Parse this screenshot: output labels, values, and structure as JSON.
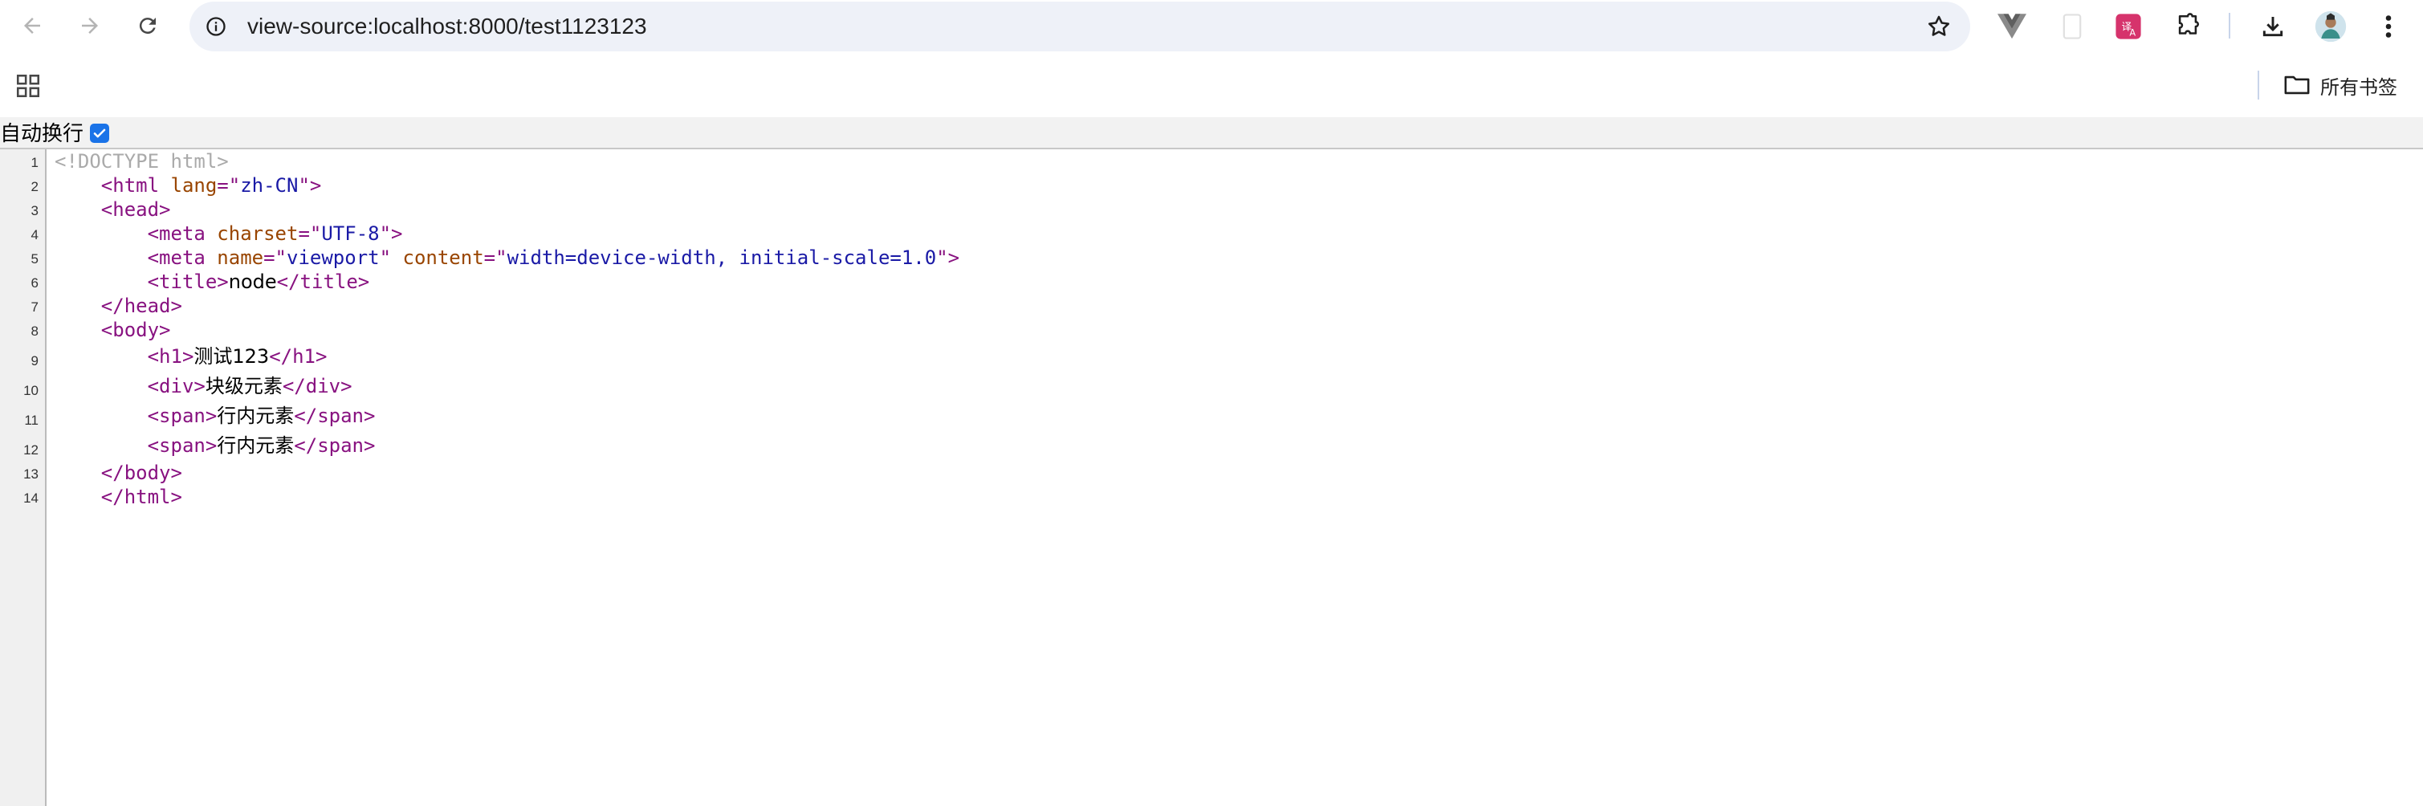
{
  "browser": {
    "url": "view-source:localhost:8000/test1123123",
    "bookmarks_all_label": "所有书签",
    "colors": {
      "omnibox_bg": "#eef1f8",
      "accent": "#1a73e8"
    }
  },
  "wrap": {
    "label": "自动换行",
    "checked": true
  },
  "source": {
    "lines": [
      {
        "n": "1",
        "indent": "",
        "parts": [
          {
            "c": "doctype",
            "t": "<!DOCTYPE html>"
          }
        ]
      },
      {
        "n": "2",
        "indent": "    ",
        "parts": [
          {
            "c": "tag",
            "t": "<html "
          },
          {
            "c": "attr",
            "t": "lang"
          },
          {
            "c": "tag",
            "t": "=\""
          },
          {
            "c": "val",
            "t": "zh-CN"
          },
          {
            "c": "tag",
            "t": "\">"
          }
        ]
      },
      {
        "n": "3",
        "indent": "    ",
        "parts": [
          {
            "c": "tag",
            "t": "<head>"
          }
        ]
      },
      {
        "n": "4",
        "indent": "        ",
        "parts": [
          {
            "c": "tag",
            "t": "<meta "
          },
          {
            "c": "attr",
            "t": "charset"
          },
          {
            "c": "tag",
            "t": "=\""
          },
          {
            "c": "val",
            "t": "UTF-8"
          },
          {
            "c": "tag",
            "t": "\">"
          }
        ]
      },
      {
        "n": "5",
        "indent": "        ",
        "parts": [
          {
            "c": "tag",
            "t": "<meta "
          },
          {
            "c": "attr",
            "t": "name"
          },
          {
            "c": "tag",
            "t": "=\""
          },
          {
            "c": "val",
            "t": "viewport"
          },
          {
            "c": "tag",
            "t": "\" "
          },
          {
            "c": "attr",
            "t": "content"
          },
          {
            "c": "tag",
            "t": "=\""
          },
          {
            "c": "val",
            "t": "width=device-width, initial-scale=1.0"
          },
          {
            "c": "tag",
            "t": "\">"
          }
        ]
      },
      {
        "n": "6",
        "indent": "        ",
        "parts": [
          {
            "c": "tag",
            "t": "<title>"
          },
          {
            "c": "plain",
            "t": "node"
          },
          {
            "c": "tag",
            "t": "</title>"
          }
        ]
      },
      {
        "n": "7",
        "indent": "    ",
        "parts": [
          {
            "c": "tag",
            "t": "</head>"
          }
        ]
      },
      {
        "n": "8",
        "indent": "    ",
        "parts": [
          {
            "c": "tag",
            "t": "<body>"
          }
        ]
      },
      {
        "n": "9",
        "indent": "        ",
        "parts": [
          {
            "c": "tag",
            "t": "<h1>"
          },
          {
            "c": "plain",
            "t": "测试123"
          },
          {
            "c": "tag",
            "t": "</h1>"
          }
        ]
      },
      {
        "n": "10",
        "indent": "        ",
        "parts": [
          {
            "c": "tag",
            "t": "<div>"
          },
          {
            "c": "plain",
            "t": "块级元素"
          },
          {
            "c": "tag",
            "t": "</div>"
          }
        ]
      },
      {
        "n": "11",
        "indent": "        ",
        "parts": [
          {
            "c": "tag",
            "t": "<span>"
          },
          {
            "c": "plain",
            "t": "行内元素"
          },
          {
            "c": "tag",
            "t": "</span>"
          }
        ]
      },
      {
        "n": "12",
        "indent": "        ",
        "parts": [
          {
            "c": "tag",
            "t": "<span>"
          },
          {
            "c": "plain",
            "t": "行内元素"
          },
          {
            "c": "tag",
            "t": "</span>"
          }
        ]
      },
      {
        "n": "13",
        "indent": "    ",
        "parts": [
          {
            "c": "tag",
            "t": "</body>"
          }
        ]
      },
      {
        "n": "14",
        "indent": "    ",
        "parts": [
          {
            "c": "tag",
            "t": "</html>"
          }
        ]
      }
    ]
  }
}
